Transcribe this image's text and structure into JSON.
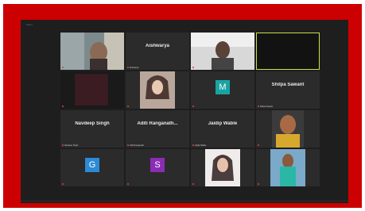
{
  "window": {
    "title": "Zoom"
  },
  "colors": {
    "frame": "#cc0000",
    "active_border": "#c9e04a",
    "avatar_m": "#1aa3a3",
    "avatar_g": "#2d8ad6",
    "avatar_s": "#8a2db5"
  },
  "tiles": [
    {
      "type": "video",
      "label": ""
    },
    {
      "type": "name",
      "display": "Aishwarya",
      "label": "Aishwarya"
    },
    {
      "type": "video",
      "label": ""
    },
    {
      "type": "video",
      "label": "",
      "active": true
    },
    {
      "type": "video",
      "label": ""
    },
    {
      "type": "video",
      "label": ""
    },
    {
      "type": "avatar",
      "letter": "M",
      "icon": "avatar-letter",
      "label": ""
    },
    {
      "type": "name",
      "display": "Shilpa Sawant",
      "label": "Shilpa Sawant"
    },
    {
      "type": "name",
      "display": "Navdeep Singh",
      "label": "Navdeep Singh"
    },
    {
      "type": "name",
      "display": "Aditi Ranganath...",
      "label": "Aditi Ranganath"
    },
    {
      "type": "name",
      "display": "Jaidip Wable",
      "label": "Jaidip Wable"
    },
    {
      "type": "video",
      "label": ""
    },
    {
      "type": "avatar",
      "letter": "G",
      "icon": "avatar-letter",
      "label": ""
    },
    {
      "type": "avatar",
      "letter": "S",
      "icon": "avatar-letter",
      "label": ""
    },
    {
      "type": "video",
      "label": ""
    },
    {
      "type": "video",
      "label": ""
    }
  ]
}
